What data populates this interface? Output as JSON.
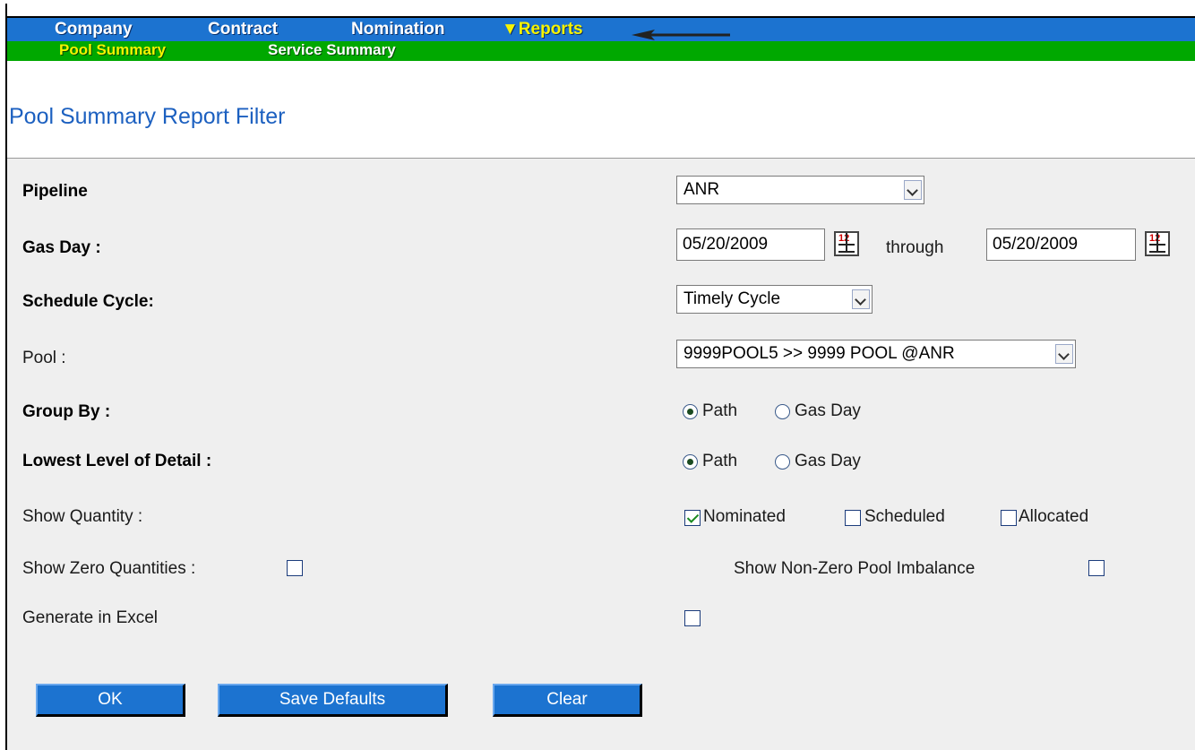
{
  "top_nav": {
    "items": [
      {
        "label": "Company"
      },
      {
        "label": "Contract"
      },
      {
        "label": "Nomination"
      },
      {
        "label": "▼Reports"
      }
    ]
  },
  "sub_nav": {
    "items": [
      {
        "label": "Pool Summary"
      },
      {
        "label": "Service Summary"
      }
    ]
  },
  "page_title": "Pool Summary Report Filter",
  "form": {
    "pipeline": {
      "label": "Pipeline",
      "value": "ANR"
    },
    "gas_day": {
      "label": "Gas Day :",
      "from": "05/20/2009",
      "through_label": "through",
      "to": "05/20/2009"
    },
    "schedule_cycle": {
      "label": "Schedule Cycle:",
      "value": "Timely Cycle"
    },
    "pool": {
      "label": "Pool :",
      "value": "9999POOL5 >> 9999 POOL @ANR"
    },
    "group_by": {
      "label": "Group By :",
      "options": [
        "Path",
        "Gas Day"
      ],
      "selected": "Path"
    },
    "lowest_level": {
      "label": "Lowest Level of Detail :",
      "options": [
        "Path",
        "Gas Day"
      ],
      "selected": "Path"
    },
    "show_quantity": {
      "label": "Show Quantity :",
      "options": [
        {
          "label": "Nominated",
          "checked": true
        },
        {
          "label": "Scheduled",
          "checked": false
        },
        {
          "label": "Allocated",
          "checked": false
        }
      ]
    },
    "show_zero": {
      "label": "Show Zero Quantities :",
      "checked": false
    },
    "show_nonzero_imbalance": {
      "label": "Show Non-Zero Pool Imbalance",
      "checked": false
    },
    "generate_excel": {
      "label": "Generate in Excel",
      "checked": false
    }
  },
  "buttons": {
    "ok": "OK",
    "save_defaults": "Save Defaults",
    "clear": "Clear"
  },
  "calendar_icon": {
    "name": "calendar-icon",
    "glyph_text": "12"
  },
  "colors": {
    "top_nav_bg": "#1c73d0",
    "sub_nav_bg": "#00a800",
    "active_nav_text": "#f7f300",
    "title_text": "#1c60c0",
    "button_bg": "#1c73d0"
  }
}
